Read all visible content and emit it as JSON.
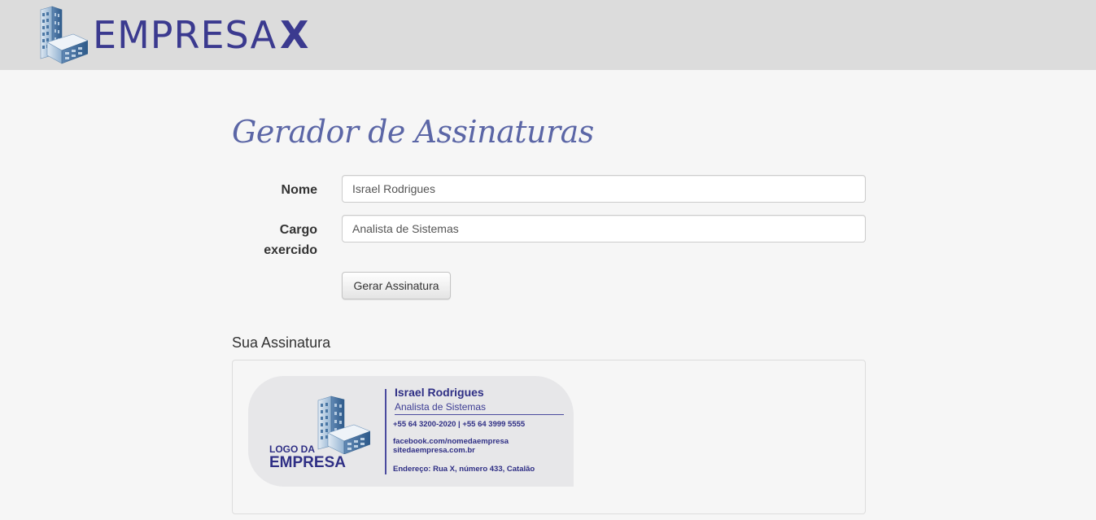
{
  "header": {
    "brand_name": "EMPRESA",
    "brand_suffix": "X",
    "brand_color": "#3b3a8f",
    "logo_icon": "building-icon"
  },
  "form": {
    "title": "Gerador de Assinaturas",
    "name_label": "Nome",
    "name_value": "Israel Rodrigues",
    "role_label_line1": "Cargo",
    "role_label_line2": "exercido",
    "role_value": "Analista de Sistemas",
    "submit_label": "Gerar Assinatura"
  },
  "signature": {
    "section_title": "Sua Assinatura",
    "logo_line1": "LOGO DA",
    "logo_line2": "EMPRESA",
    "name": "Israel Rodrigues",
    "role": "Analista de Sistemas",
    "phones": "+55 64 3200-2020 | +55 64 3999 5555",
    "facebook": "facebook.com/nomedaempresa",
    "website": "sitedaempresa.com.br",
    "address": "Endereço: Rua X, número 433, Catalão",
    "accent_color": "#2f2f85"
  }
}
